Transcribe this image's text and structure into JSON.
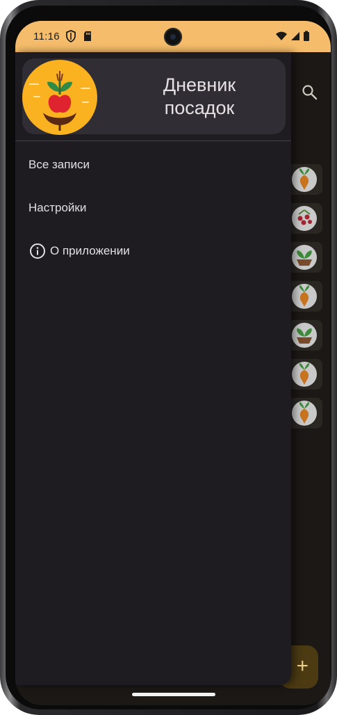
{
  "status_bar": {
    "time": "11:16",
    "background": "#f5bd6b",
    "left_icons": [
      "shield-icon",
      "sd-card-icon"
    ],
    "right_icons": [
      "wifi-icon",
      "signal-icon",
      "battery-icon"
    ]
  },
  "background_app": {
    "icons": [
      "search-icon",
      "add-icon"
    ],
    "fab_label": "+",
    "entries": [
      {
        "icon": "beet-icon"
      },
      {
        "icon": "berries-icon"
      },
      {
        "icon": "seedling-pot-icon"
      },
      {
        "icon": "beet-icon"
      },
      {
        "icon": "seedling-pot-icon"
      },
      {
        "icon": "beet-icon"
      },
      {
        "icon": "beet-icon"
      }
    ]
  },
  "drawer": {
    "header": {
      "logo_icon": "sprout-apple-logo",
      "title_line1": "Дневник",
      "title_line2": "посадок"
    },
    "menu": [
      {
        "label": "Все записи"
      },
      {
        "label": "Настройки"
      },
      {
        "label": "О приложении",
        "icon": "info-icon"
      }
    ]
  },
  "colors": {
    "drawer_bg": "#1e1c20",
    "header_bg": "#302d34",
    "accent": "#f5bd6b",
    "logo_bg": "#fbb221"
  }
}
